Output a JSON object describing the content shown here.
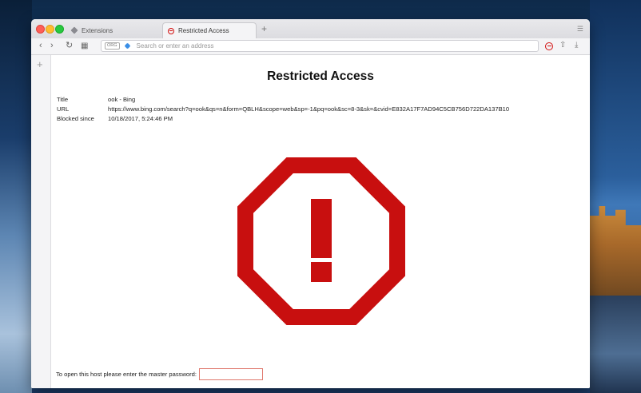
{
  "window": {
    "tabs": [
      {
        "label": "Extensions",
        "icon": "extension-cube-icon",
        "active": false
      },
      {
        "label": "Restricted Access",
        "icon": "restricted-icon",
        "active": true
      }
    ],
    "new_tab": "+",
    "menu_icon": "tabs-menu-icon"
  },
  "toolbar": {
    "address_placeholder": "Search or enter an address",
    "address_badge": "ORG"
  },
  "page": {
    "title": "Restricted Access",
    "info": [
      {
        "label": "Title",
        "value": "ook - Bing"
      },
      {
        "label": "URL",
        "value": "https://www.bing.com/search?q=ook&qs=n&form=QBLH&scope=web&sp=-1&pq=ook&sc=8-3&sk=&cvid=E832A17F7AD94C5CB756D722DA137B10"
      },
      {
        "label": "Blocked since",
        "value": "10/18/2017, 5:24:46 PM"
      }
    ],
    "password_prompt": "To open this host please enter the master password:",
    "password_value": "",
    "stop_color": "#c80f0f"
  }
}
